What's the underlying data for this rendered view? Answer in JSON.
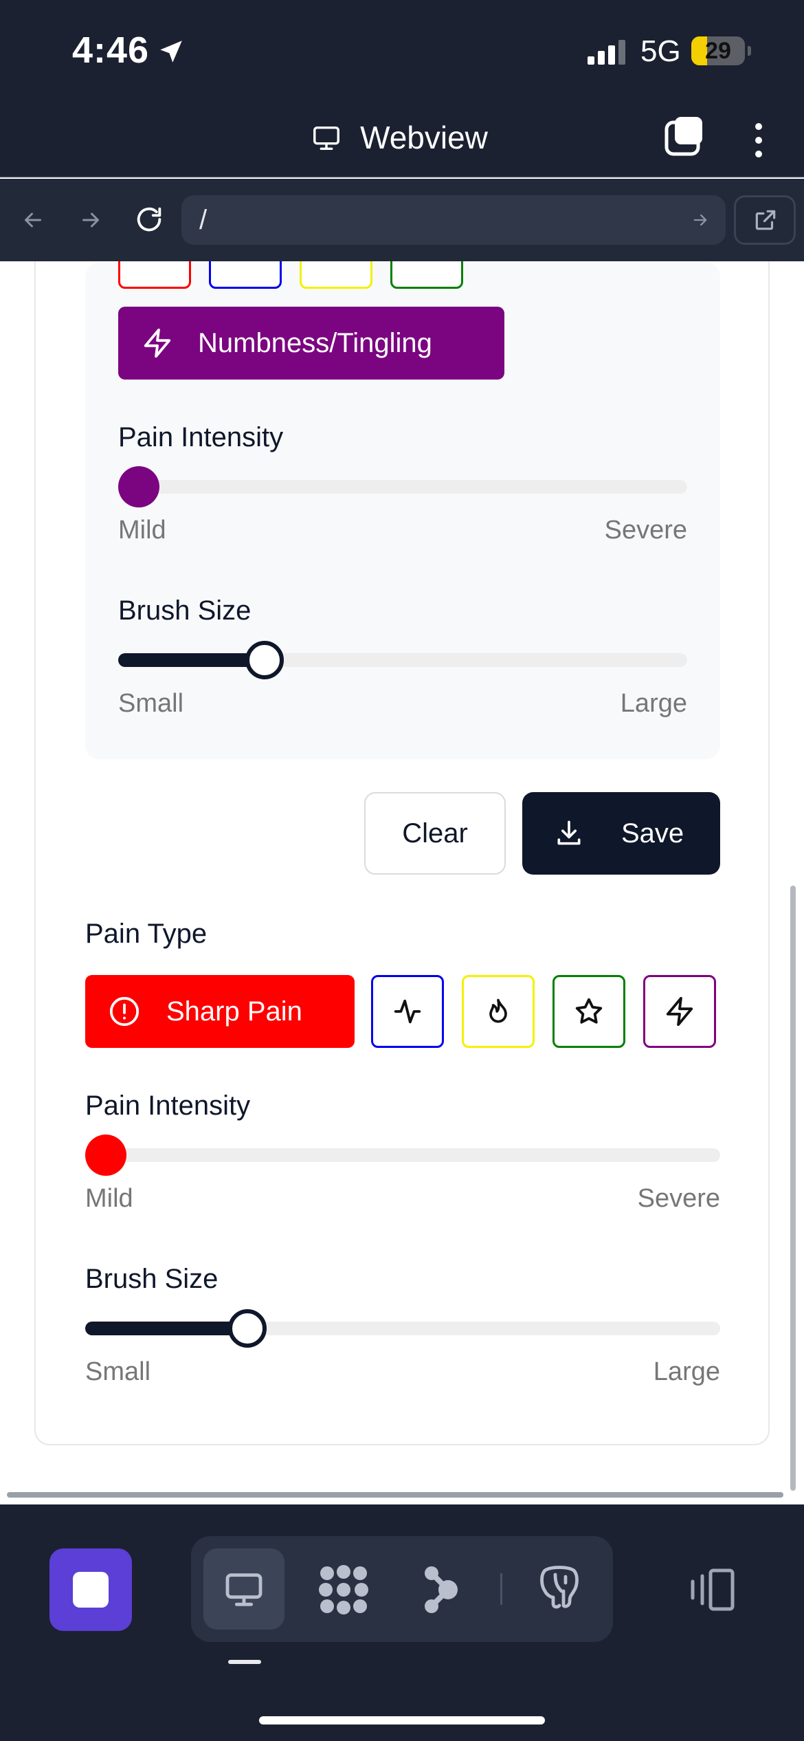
{
  "status_bar": {
    "time": "4:46",
    "network": "5G",
    "battery": "29",
    "battery_level": 0.29
  },
  "header": {
    "title": "Webview"
  },
  "browser": {
    "url": "/"
  },
  "top_panel": {
    "numbness_label": "Numbness/Tingling",
    "pain_intensity_label": "Pain Intensity",
    "mild_label": "Mild",
    "severe_label": "Severe",
    "intensity_value": 0.0,
    "brush_size_label": "Brush Size",
    "small_label": "Small",
    "large_label": "Large",
    "brush_value": 0.24,
    "accent_color": "#7b0580"
  },
  "actions": {
    "clear_label": "Clear",
    "save_label": "Save"
  },
  "bottom_panel": {
    "pain_type_label": "Pain Type",
    "selected_type_label": "Sharp Pain",
    "pain_intensity_label": "Pain Intensity",
    "mild_label": "Mild",
    "severe_label": "Severe",
    "intensity_value": 0.0,
    "brush_size_label": "Brush Size",
    "small_label": "Small",
    "large_label": "Large",
    "brush_value": 0.24,
    "accent_color": "#ff0000"
  },
  "pain_types": [
    {
      "name": "sharp",
      "icon": "alert-circle-icon",
      "color": "#ff0000"
    },
    {
      "name": "throbbing",
      "icon": "activity-icon",
      "color": "#0000ee"
    },
    {
      "name": "burning",
      "icon": "flame-icon",
      "color": "#f5f000"
    },
    {
      "name": "aching",
      "icon": "star-icon",
      "color": "#008000"
    },
    {
      "name": "numbness",
      "icon": "zap-icon",
      "color": "#800080"
    }
  ],
  "dock": {
    "items": [
      "monitor-icon",
      "grid-dots-icon",
      "graph-icon",
      "elephant-icon"
    ]
  },
  "colors": {
    "dark": "#0f172a",
    "chrome": "#1b2130",
    "launcher": "#5b3fd6"
  }
}
